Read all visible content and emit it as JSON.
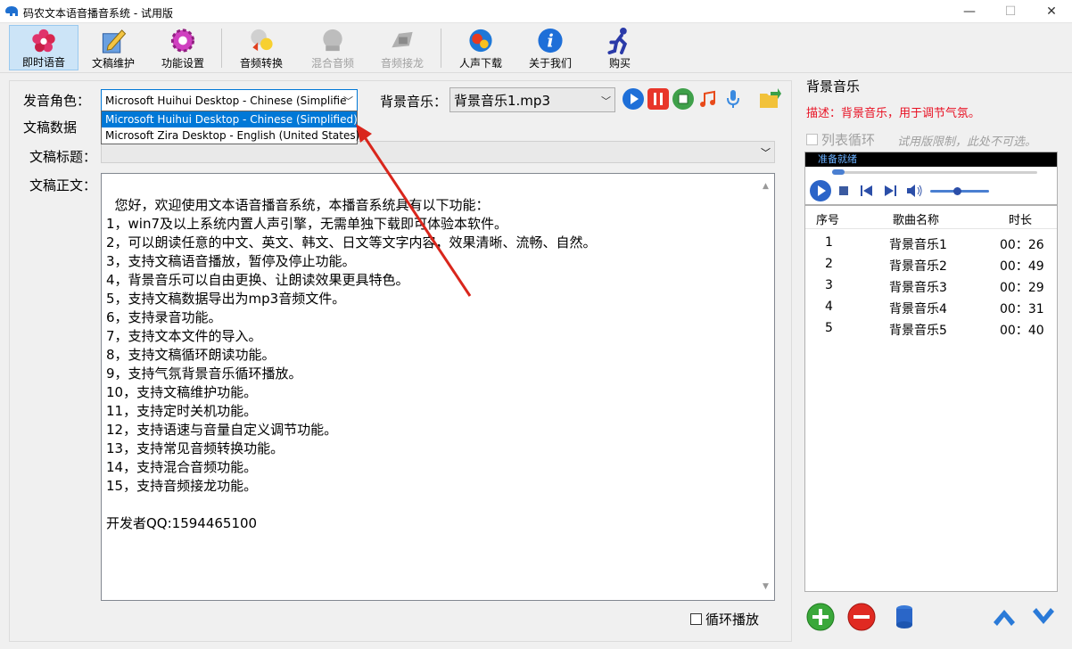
{
  "window": {
    "title": "码农文本语音播音系统 - 试用版",
    "min_glyph": "—",
    "max_glyph": "☐",
    "close_glyph": "✕"
  },
  "toolbar": {
    "items": [
      {
        "label": "即时语音",
        "icon": "flower-icon"
      },
      {
        "label": "文稿维护",
        "icon": "edit-doc-icon"
      },
      {
        "label": "功能设置",
        "icon": "gear-icon"
      },
      {
        "label": "音频转换",
        "icon": "audio-convert-icon"
      },
      {
        "label": "混合音频",
        "icon": "mix-audio-icon"
      },
      {
        "label": "音频接龙",
        "icon": "audio-chain-icon"
      },
      {
        "label": "人声下载",
        "icon": "voice-download-icon"
      },
      {
        "label": "关于我们",
        "icon": "info-icon"
      },
      {
        "label": "购买",
        "icon": "runner-icon"
      }
    ]
  },
  "form": {
    "voice_label": "发音角色：",
    "voice_value": "Microsoft Huihui Desktop - Chinese (Simplifie",
    "voice_options": [
      "Microsoft Huihui Desktop - Chinese (Simplified)",
      "Microsoft Zira Desktop - English (United States)"
    ],
    "bg_music_label": "背景音乐：",
    "bg_music_value": "背景音乐1.mp3",
    "section_label": "文稿数据",
    "doc_title_label": "文稿标题：",
    "doc_body_label": "文稿正文：",
    "doc_body": "您好，欢迎使用文本语音播音系统，本播音系统具有以下功能：\n1，win7及以上系统内置人声引擎，无需单独下载即可体验本软件。\n2，可以朗读任意的中文、英文、韩文、日文等文字内容，效果清晰、流畅、自然。\n3，支持文稿语音播放，暂停及停止功能。\n4，背景音乐可以自由更换、让朗读效果更具特色。\n5，支持文稿数据导出为mp3音频文件。\n6，支持录音功能。\n7，支持文本文件的导入。\n8，支持文稿循环朗读功能。\n9，支持气氛背景音乐循环播放。\n10，支持文稿维护功能。\n11，支持定时关机功能。\n12，支持语速与音量自定义调节功能。\n13，支持常见音频转换功能。\n14，支持混合音频功能。\n15，支持音频接龙功能。\n\n开发者QQ:1594465100",
    "loop_play_label": "循环播放"
  },
  "right_panel": {
    "title": "背景音乐",
    "description": "描述：背景音乐，用于调节气氛。",
    "list_loop_label": "列表循环",
    "trial_limit": "试用版限制，此处不可选。",
    "player_status": "准备就绪",
    "playlist_headers": {
      "index": "序号",
      "name": "歌曲名称",
      "duration": "时长"
    },
    "playlist": [
      {
        "index": "1",
        "name": "背景音乐1",
        "duration": "00：26"
      },
      {
        "index": "2",
        "name": "背景音乐2",
        "duration": "00：49"
      },
      {
        "index": "3",
        "name": "背景音乐3",
        "duration": "00：29"
      },
      {
        "index": "4",
        "name": "背景音乐4",
        "duration": "00：31"
      },
      {
        "index": "5",
        "name": "背景音乐5",
        "duration": "00：40"
      }
    ]
  },
  "colors": {
    "accent": "#0078d7",
    "description_red": "#e81123",
    "annotation_arrow": "#d9261c"
  }
}
